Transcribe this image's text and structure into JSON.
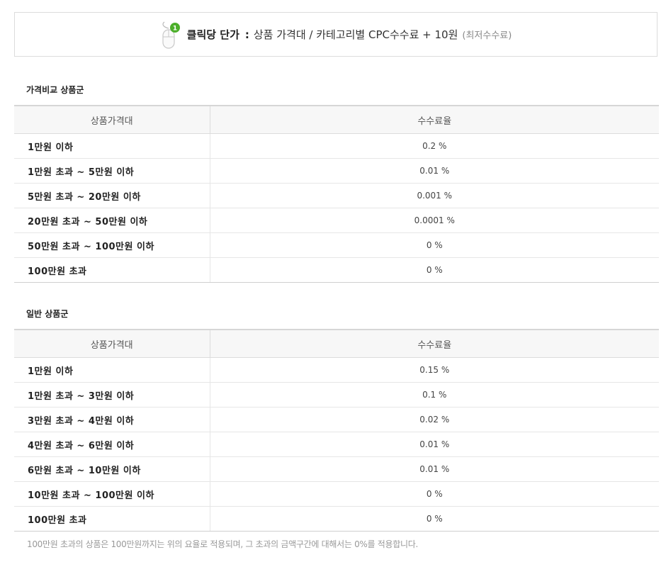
{
  "banner": {
    "title": "클릭당 단가",
    "colon": ":",
    "formula": "상품 가격대 / 카테고리별 CPC수수료 + 10원",
    "note": "(최저수수료)",
    "badge": "1",
    "icon": "mouse-icon"
  },
  "columns": {
    "range": "상품가격대",
    "rate": "수수료율"
  },
  "comparison": {
    "title": "가격비교 상품군",
    "rows": [
      {
        "range": "1만원 이하",
        "rate": "0.2 %"
      },
      {
        "range": "1만원 초과 ~ 5만원 이하",
        "rate": "0.01 %"
      },
      {
        "range": "5만원 초과 ~ 20만원 이하",
        "rate": "0.001 %"
      },
      {
        "range": "20만원 초과 ~ 50만원 이하",
        "rate": "0.0001 %"
      },
      {
        "range": "50만원 초과 ~ 100만원 이하",
        "rate": "0 %"
      },
      {
        "range": "100만원 초과",
        "rate": "0 %"
      }
    ]
  },
  "general": {
    "title": "일반 상품군",
    "rows": [
      {
        "range": "1만원 이하",
        "rate": "0.15 %"
      },
      {
        "range": "1만원 초과 ~ 3만원 이하",
        "rate": "0.1 %"
      },
      {
        "range": "3만원 초과 ~ 4만원 이하",
        "rate": "0.02 %"
      },
      {
        "range": "4만원 초과 ~ 6만원 이하",
        "rate": "0.01 %"
      },
      {
        "range": "6만원 초과 ~ 10만원 이하",
        "rate": "0.01 %"
      },
      {
        "range": "10만원 초과 ~ 100만원 이하",
        "rate": "0 %"
      },
      {
        "range": "100만원 초과",
        "rate": "0 %"
      }
    ]
  },
  "footnote": "100만원 초과의 상품은 100만원까지는 위의 요율로 적용되며, 그 초과의 금액구간에 대해서는 0%를 적용합니다.",
  "colors": {
    "badge": "#4caf2a",
    "header_bg": "#f7f7f7",
    "border": "#dcdcdc",
    "footnote": "#999999"
  }
}
